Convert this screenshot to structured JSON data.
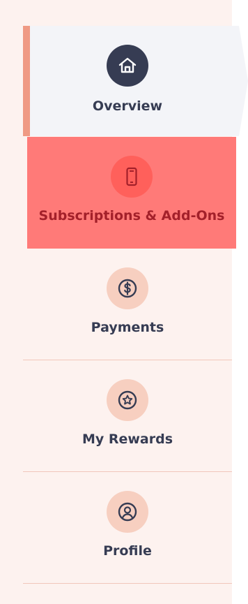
{
  "nav": {
    "items": [
      {
        "label": "Overview",
        "icon": "home-icon",
        "active": true
      },
      {
        "label": "Subscriptions & Add-Ons",
        "icon": "phone-icon",
        "highlighted": true
      },
      {
        "label": "Payments",
        "icon": "dollar-icon"
      },
      {
        "label": "My Rewards",
        "icon": "star-icon"
      },
      {
        "label": "Profile",
        "icon": "user-icon"
      }
    ]
  },
  "colors": {
    "sidebar_bg": "#fdf2ef",
    "active_bg": "#f3f4f8",
    "accent": "#ef9a84",
    "highlight_bg": "#ff7a78",
    "highlight_text": "#a3202a",
    "icon_circle": "#f7cfc0",
    "text": "#363c53"
  }
}
